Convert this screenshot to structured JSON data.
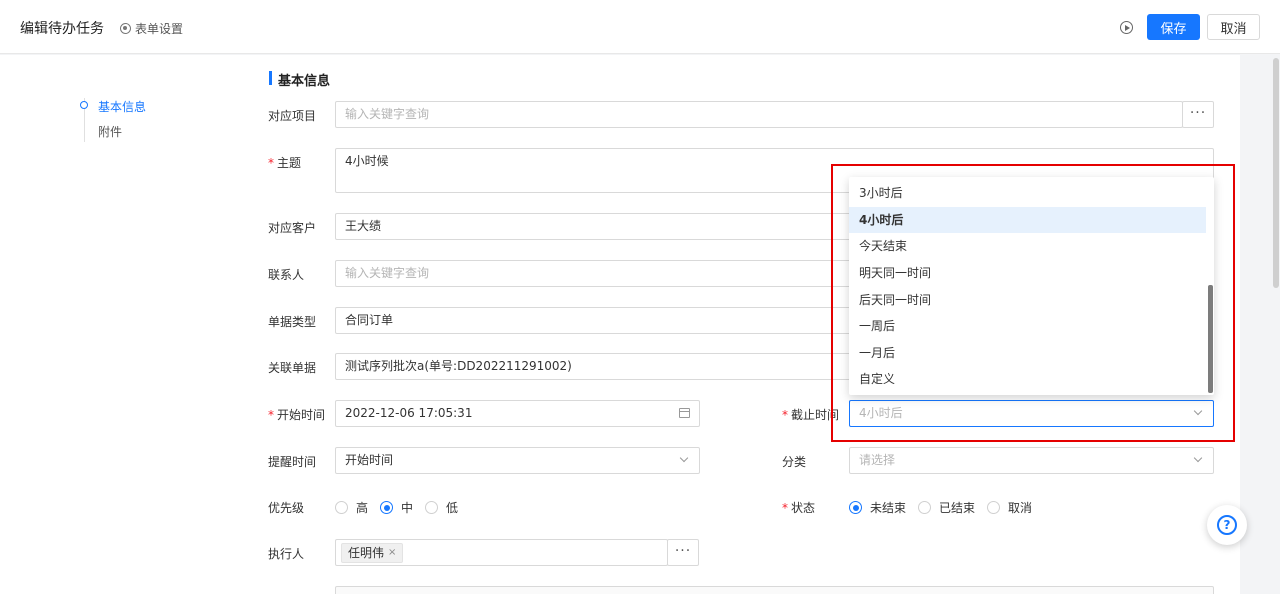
{
  "header": {
    "title": "编辑待办任务",
    "form_setting": "表单设置",
    "save_label": "保存",
    "cancel_label": "取消"
  },
  "anchor_nav": {
    "items": [
      {
        "label": "基本信息",
        "active": true
      },
      {
        "label": "附件",
        "active": false
      }
    ]
  },
  "section": {
    "title": "基本信息"
  },
  "fields": {
    "project": {
      "label": "对应项目",
      "placeholder": "输入关键字查询"
    },
    "subject": {
      "label": "主题",
      "required": true,
      "value": "4小时候"
    },
    "customer": {
      "label": "对应客户",
      "value": "王大绩"
    },
    "contact": {
      "label": "联系人",
      "placeholder": "输入关键字查询"
    },
    "doc_type": {
      "label": "单据类型",
      "value": "合同订单"
    },
    "related_doc": {
      "label": "关联单据",
      "value": "测试序列批次a(单号:DD202211291002)"
    },
    "start_time": {
      "label": "开始时间",
      "required": true,
      "value": "2022-12-06 17:05:31"
    },
    "deadline": {
      "label": "截止时间",
      "required": true,
      "value": "4小时后"
    },
    "reminder": {
      "label": "提醒时间",
      "value": "开始时间"
    },
    "category": {
      "label": "分类",
      "placeholder": "请选择"
    },
    "priority": {
      "label": "优先级",
      "options": [
        "高",
        "中",
        "低"
      ],
      "selected": "中"
    },
    "status": {
      "label": "状态",
      "required": true,
      "options": [
        "未结束",
        "已结束",
        "取消"
      ],
      "selected": "未结束"
    },
    "assignee": {
      "label": "执行人",
      "tags": [
        "任明伟"
      ]
    }
  },
  "deadline_dropdown": {
    "options": [
      "3小时后",
      "4小时后",
      "今天结束",
      "明天同一时间",
      "后天同一时间",
      "一周后",
      "一月后",
      "自定义"
    ],
    "selected": "4小时后"
  },
  "more_glyph": "···",
  "tag_close_glyph": "×",
  "help_glyph": "?",
  "colors": {
    "primary": "#1677ff",
    "highlight": "#e50000",
    "required": "#f5222d"
  }
}
